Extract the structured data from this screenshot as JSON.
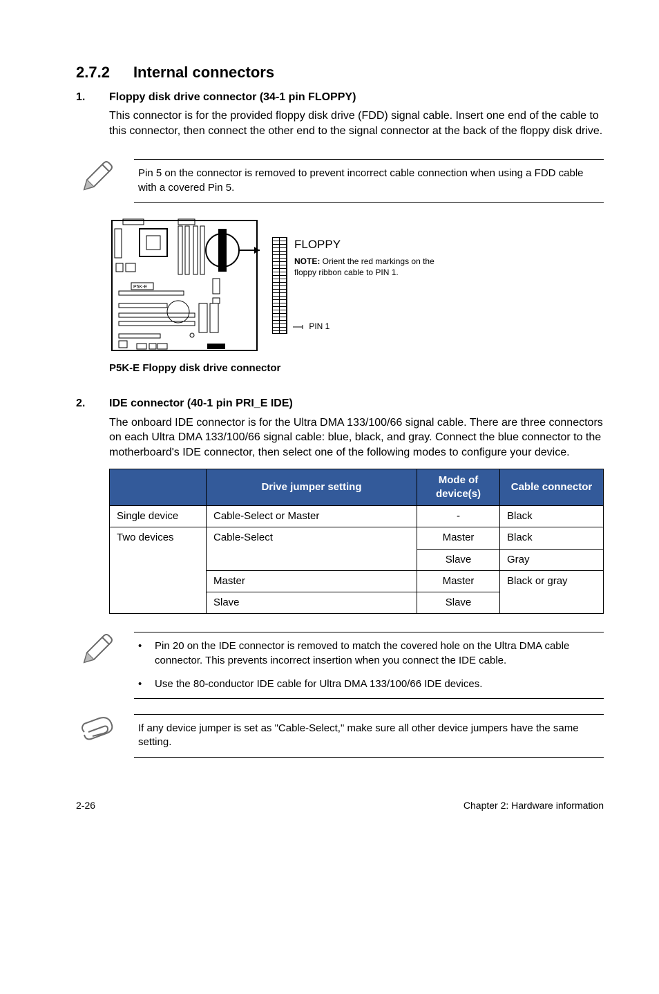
{
  "section": {
    "number": "2.7.2",
    "title": "Internal connectors"
  },
  "item1": {
    "num": "1.",
    "title": "Floppy disk drive connector (34-1 pin FLOPPY)",
    "para": "This connector is for the provided floppy disk drive (FDD) signal cable. Insert one end of the cable to this connector, then connect the other end to the signal connector at the back of the floppy disk drive."
  },
  "note1": "Pin 5 on the connector is removed to prevent incorrect cable connection when using a FDD cable with a covered Pin 5.",
  "diagram": {
    "board_label": "P5K-E",
    "conn_label": "FLOPPY",
    "note_bold": "NOTE:",
    "note_text": " Orient the red markings on the floppy ribbon cable to PIN 1.",
    "pin1": "PIN 1",
    "caption": "P5K-E Floppy disk drive connector"
  },
  "item2": {
    "num": "2.",
    "title": "IDE connector (40-1 pin PRI_E IDE)",
    "para": "The onboard IDE connector is for the Ultra DMA 133/100/66 signal cable. There are three connectors on each Ultra DMA 133/100/66 signal cable: blue, black, and gray. Connect the blue connector to the motherboard's IDE connector, then select one of the following modes to configure your device."
  },
  "table": {
    "headers": {
      "h1": "",
      "h2": "Drive jumper setting",
      "h3": "Mode of device(s)",
      "h4": "Cable connector"
    },
    "r1": {
      "c1": "Single device",
      "c2": "Cable-Select or Master",
      "c3": "-",
      "c4": "Black"
    },
    "r2": {
      "c1": "Two devices",
      "c2": "Cable-Select",
      "c3": "Master",
      "c4": "Black"
    },
    "r3": {
      "c3": "Slave",
      "c4": "Gray"
    },
    "r4": {
      "c2": "Master",
      "c3": "Master",
      "c4": "Black or gray"
    },
    "r5": {
      "c2": "Slave",
      "c3": "Slave"
    }
  },
  "note2": {
    "b1": "Pin 20 on the IDE connector is removed to match the covered hole on the Ultra DMA cable connector. This prevents incorrect insertion when you connect the IDE cable.",
    "b2": "Use the 80-conductor IDE cable for Ultra DMA 133/100/66 IDE devices."
  },
  "note3": "If any device jumper is set as \"Cable-Select,\" make sure all other device jumpers have the same setting.",
  "footer": {
    "left": "2-26",
    "right": "Chapter 2: Hardware information"
  }
}
